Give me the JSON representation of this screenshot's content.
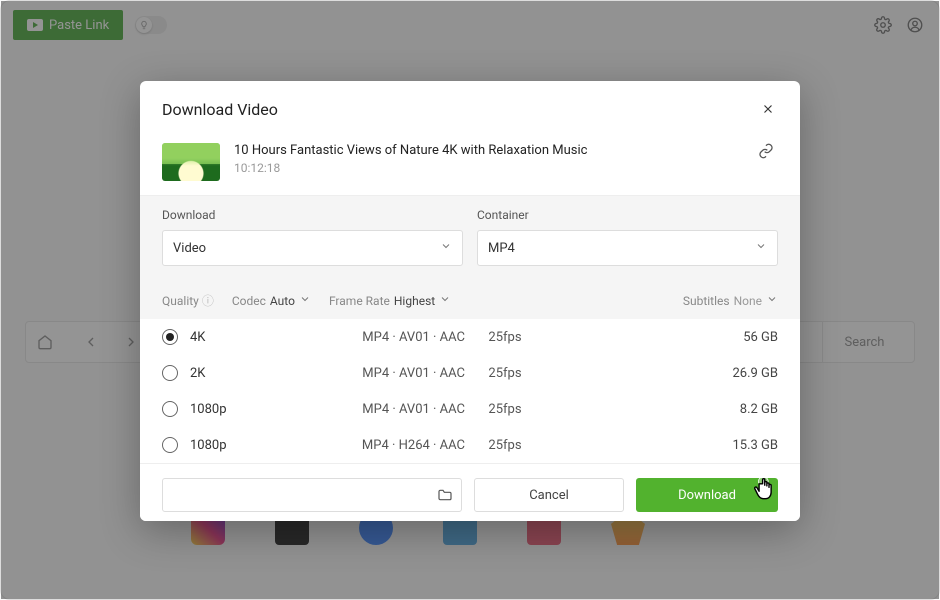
{
  "topbar": {
    "paste_label": "Paste Link"
  },
  "browser_bar": {
    "search_label": "Search"
  },
  "modal": {
    "title": "Download Video",
    "video": {
      "title": "10 Hours Fantastic Views of Nature 4K with Relaxation Music",
      "duration": "10:12:18"
    },
    "selects": {
      "download": {
        "label": "Download",
        "value": "Video"
      },
      "container": {
        "label": "Container",
        "value": "MP4"
      }
    },
    "filters": {
      "quality_label": "Quality",
      "codec_label": "Codec",
      "codec_value": "Auto",
      "framerate_label": "Frame Rate",
      "framerate_value": "Highest",
      "subtitles_label": "Subtitles",
      "subtitles_value": "None"
    },
    "qualities": [
      {
        "label": "4K",
        "format": "MP4 · AV01 · AAC",
        "fps": "25fps",
        "size": "56 GB",
        "selected": true
      },
      {
        "label": "2K",
        "format": "MP4 · AV01 · AAC",
        "fps": "25fps",
        "size": "26.9 GB",
        "selected": false
      },
      {
        "label": "1080p",
        "format": "MP4 · AV01 · AAC",
        "fps": "25fps",
        "size": "8.2 GB",
        "selected": false
      },
      {
        "label": "1080p",
        "format": "MP4 · H264 · AAC",
        "fps": "25fps",
        "size": "15.3 GB",
        "selected": false
      }
    ],
    "footer": {
      "cancel_label": "Cancel",
      "download_label": "Download"
    }
  },
  "colors": {
    "accent_green": "#52b22e"
  }
}
